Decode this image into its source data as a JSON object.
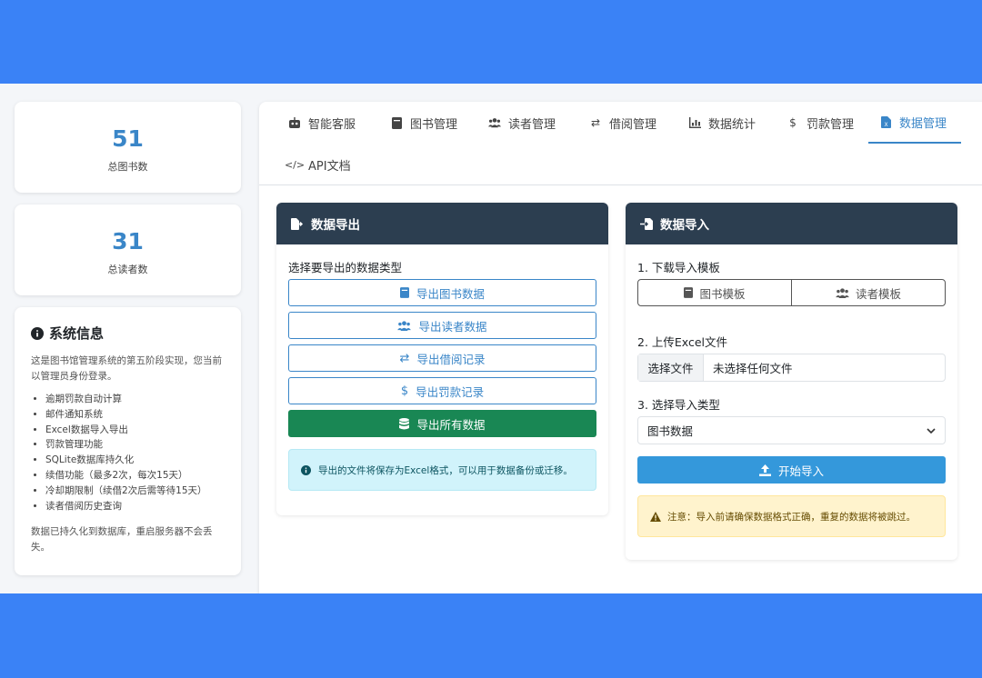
{
  "stats": [
    {
      "value": "51",
      "label": "总图书数"
    },
    {
      "value": "31",
      "label": "总读者数"
    }
  ],
  "sysinfo": {
    "title": "系统信息",
    "desc": "这是图书馆管理系统的第五阶段实现，您当前以管理员身份登录。",
    "features": [
      "逾期罚款自动计算",
      "邮件通知系统",
      "Excel数据导入导出",
      "罚款管理功能",
      "SQLite数据库持久化",
      "续借功能（最多2次，每次15天）",
      "冷却期限制（续借2次后需等待15天）",
      "读者借阅历史查询"
    ],
    "footer": "数据已持久化到数据库，重启服务器不会丢失。"
  },
  "tabs": [
    {
      "label": "智能客服",
      "icon": "robot-icon"
    },
    {
      "label": "图书管理",
      "icon": "book-icon"
    },
    {
      "label": "读者管理",
      "icon": "users-icon"
    },
    {
      "label": "借阅管理",
      "icon": "exchange-icon"
    },
    {
      "label": "数据统计",
      "icon": "chart-icon"
    },
    {
      "label": "罚款管理",
      "icon": "dollar-icon"
    },
    {
      "label": "数据管理",
      "icon": "file-excel-icon"
    },
    {
      "label": "API文档",
      "icon": "code-icon"
    }
  ],
  "active_tab": "数据管理",
  "export_panel": {
    "title": "数据导出",
    "prompt": "选择要导出的数据类型",
    "buttons": [
      "导出图书数据",
      "导出读者数据",
      "导出借阅记录",
      "导出罚款记录",
      "导出所有数据"
    ],
    "info": "导出的文件将保存为Excel格式，可以用于数据备份或迁移。"
  },
  "import_panel": {
    "title": "数据导入",
    "step1": "1. 下载导入模板",
    "template_books": "图书模板",
    "template_readers": "读者模板",
    "step2": "2. 上传Excel文件",
    "file_button": "选择文件",
    "file_status": "未选择任何文件",
    "step3": "3. 选择导入类型",
    "import_type": "图书数据",
    "submit": "开始导入",
    "warning": "注意：导入前请确保数据格式正确，重复的数据将被跳过。"
  },
  "colors": {
    "accent": "#3a86c8",
    "header": "#2c3e50",
    "success": "#198754",
    "band": "#3a82f6"
  }
}
